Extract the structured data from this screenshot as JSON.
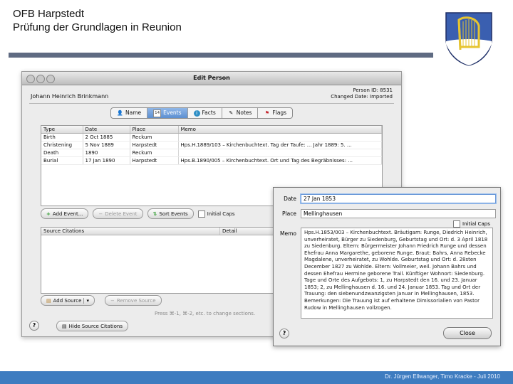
{
  "slide": {
    "title_line1": "OFB Harpstedt",
    "title_line2": "Prüfung der Grundlagen in Reunion",
    "footer": "Dr. Jürgen Ellwanger, Timo Kracke - Juli 2010"
  },
  "window": {
    "title": "Edit Person",
    "person_name": "Johann Heinrich Brinkmann",
    "person_id": "Person ID: 8531",
    "changed_date": "Changed Date: Imported",
    "tabs": [
      {
        "label": "Name",
        "icon": "person-icon"
      },
      {
        "label": "Events",
        "icon": "calendar-icon",
        "active": true,
        "icon_text": "14"
      },
      {
        "label": "Facts",
        "icon": "info-icon"
      },
      {
        "label": "Notes",
        "icon": "note-icon"
      },
      {
        "label": "Flags",
        "icon": "flag-icon"
      }
    ],
    "events_columns": [
      "Type",
      "Date",
      "Place",
      "Memo"
    ],
    "events": [
      [
        "Birth",
        "2 Oct 1885",
        "Reckum",
        ""
      ],
      [
        "Christening",
        "5 Nov 1889",
        "Harpstedt",
        "Hps.H.1889/103 – Kirchenbuchtext. Tag der Taufe: ... Jahr 1889: 5. ..."
      ],
      [
        "Death",
        "1890",
        "Reckum",
        ""
      ],
      [
        "Burial",
        "17 Jan 1890",
        "Harpstedt",
        "Hps.B.1890/005 – Kirchenbuchtext. Ort und Tag des Begräbnisses: ..."
      ]
    ],
    "buttons": {
      "add_event": "Add Event...",
      "delete_event": "Delete Event",
      "sort_events": "Sort Events",
      "initial_caps": "Initial Caps",
      "add_source": "Add Source",
      "remove_source": "Remove Source",
      "hide_citations": "Hide Source Citations"
    },
    "citation_columns": [
      "Source Citations",
      "Detail"
    ],
    "hint": "Press ⌘-1, ⌘-2, etc. to change sections."
  },
  "overlay": {
    "date_label": "Date",
    "date_value": "27 Jan 1853",
    "place_label": "Place",
    "place_value": "Mellinghausen",
    "initial_caps": "Initial Caps",
    "memo_label": "Memo",
    "memo_text": "Hps.H.1853/003 – Kirchenbuchtext. Bräutigam: Runge, Diedrich Heinrich, unverheiratet, Bürger zu Siedenburg, Geburtstag und Ort: d. 3 April 1818 zu Siedenburg. Eltern: Bürgermeister Johann Friedrich Runge und dessen Ehefrau Anna Margarethe, geborene Runge. Braut: Bahrs, Anna Rebecke Magdalene, unverheiratet, zu Wohlde. Geburtstag und Ort: d. 28sten December 1827 zu Wohlde. Eltern: Vollmeier, weil. Johann Bahrs und dessen Ehefrau Hermine geborene Trail. Künftiger Wohnort: Siedenburg. Tage und Orte des Aufgebots: 1, zu Harpstedt den 16. und 23. Januar 1853; 2, zu Mellinghausen d. 16. und 24. Januar 1853. Tag und Ort der Trauung: den siebenundzwanzigsten Januar in Mellinghausen, 1853. Bemerkungen: Die Trauung ist auf erhaltene Dimissorialien von Pastor Rudow in Mellinghausen vollzogen.",
    "close_label": "Close"
  }
}
